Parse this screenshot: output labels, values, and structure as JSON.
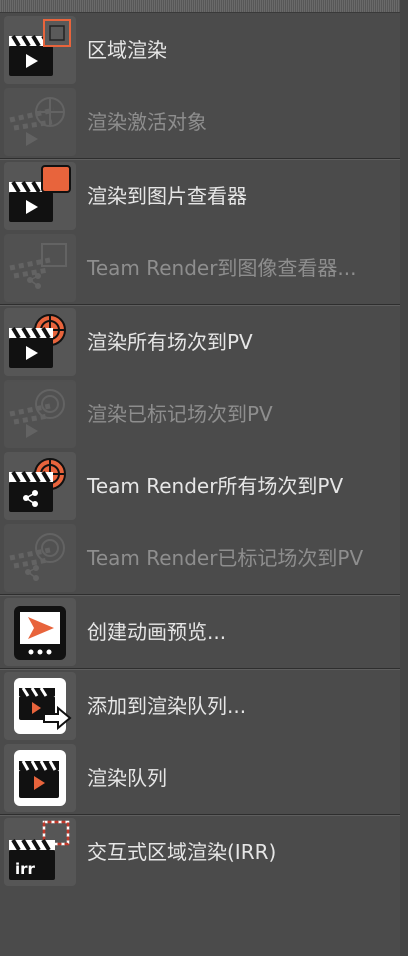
{
  "menu": {
    "groups": [
      {
        "items": [
          {
            "label": "区域渲染",
            "icon": "region-render-icon",
            "enabled": true
          },
          {
            "label": "渲染激活对象",
            "icon": "render-active-object-icon",
            "enabled": false
          }
        ]
      },
      {
        "items": [
          {
            "label": "渲染到图片查看器",
            "icon": "render-to-picture-viewer-icon",
            "enabled": true
          },
          {
            "label": "Team Render到图像查看器...",
            "icon": "team-render-to-picture-viewer-icon",
            "enabled": false
          }
        ]
      },
      {
        "items": [
          {
            "label": "渲染所有场次到PV",
            "icon": "render-all-takes-icon",
            "enabled": true
          },
          {
            "label": "渲染已标记场次到PV",
            "icon": "render-marked-takes-icon",
            "enabled": false
          },
          {
            "label": "Team Render所有场次到PV",
            "icon": "team-render-all-takes-icon",
            "enabled": true
          },
          {
            "label": "Team Render已标记场次到PV",
            "icon": "team-render-marked-takes-icon",
            "enabled": false
          }
        ]
      },
      {
        "items": [
          {
            "label": "创建动画预览...",
            "icon": "make-preview-icon",
            "enabled": true
          }
        ]
      },
      {
        "items": [
          {
            "label": "添加到渲染队列...",
            "icon": "add-to-render-queue-icon",
            "enabled": true
          },
          {
            "label": "渲染队列",
            "icon": "render-queue-icon",
            "enabled": true
          }
        ]
      },
      {
        "items": [
          {
            "label": "交互式区域渲染(IRR)",
            "icon": "interactive-render-region-icon",
            "enabled": true
          }
        ]
      }
    ]
  },
  "colors": {
    "background": "#4b4b4b",
    "accent": "#e8643c",
    "text": "#e6e6e6",
    "disabled_text": "#8e8e8e"
  },
  "icon_text": {
    "irr": "irr"
  }
}
